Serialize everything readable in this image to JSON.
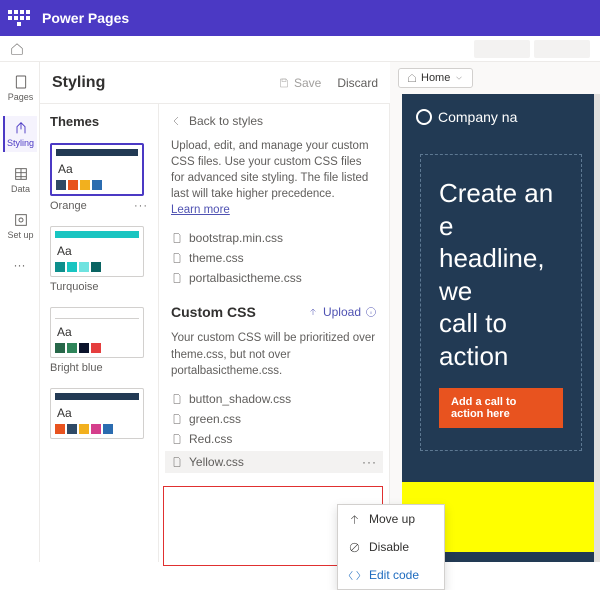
{
  "app_title": "Power Pages",
  "rail": {
    "pages": "Pages",
    "styling": "Styling",
    "data": "Data",
    "setup": "Set up"
  },
  "header": {
    "page_title": "Styling",
    "save": "Save",
    "discard": "Discard"
  },
  "themes": {
    "label": "Themes",
    "cards": [
      {
        "name": "Orange",
        "bar": "#223a54",
        "swatches": [
          "#2f4a66",
          "#e8531f",
          "#f2b01e",
          "#2b6cb0"
        ]
      },
      {
        "name": "Turquoise",
        "bar": "#19c5c1",
        "swatches": [
          "#0e8f8c",
          "#19c5c1",
          "#6fe3e0",
          "#0a6462"
        ]
      },
      {
        "name": "Bright blue",
        "bar": "#ffffff",
        "swatches": [
          "#276749",
          "#2f855a",
          "#0b132b",
          "#e53e3e"
        ]
      },
      {
        "name": "",
        "bar": "#223a54",
        "swatches": [
          "#e8531f",
          "#2f4a66",
          "#f2b01e",
          "#d53f8c",
          "#2b6cb0"
        ]
      }
    ]
  },
  "styles": {
    "back": "Back to styles",
    "desc": "Upload, edit, and manage your custom CSS files. Use your custom CSS files for advanced site styling. The file listed last will take higher precedence.",
    "learn": "Learn more",
    "base_files": [
      "bootstrap.min.css",
      "theme.css",
      "portalbasictheme.css"
    ],
    "custom_label": "Custom CSS",
    "upload": "Upload",
    "custom_desc": "Your custom CSS will be prioritized over theme.css, but not over portalbasictheme.css.",
    "custom_files": [
      "button_shadow.css",
      "green.css",
      "Red.css"
    ],
    "selected_file": "Yellow.css"
  },
  "context_menu": {
    "move_up": "Move up",
    "disable": "Disable",
    "edit": "Edit code"
  },
  "preview": {
    "breadcrumb": "Home",
    "company": "Company na",
    "headline_l1": "Create an e",
    "headline_l2": "headline, we",
    "headline_l3": "call to action",
    "cta": "Add a call to action here"
  }
}
